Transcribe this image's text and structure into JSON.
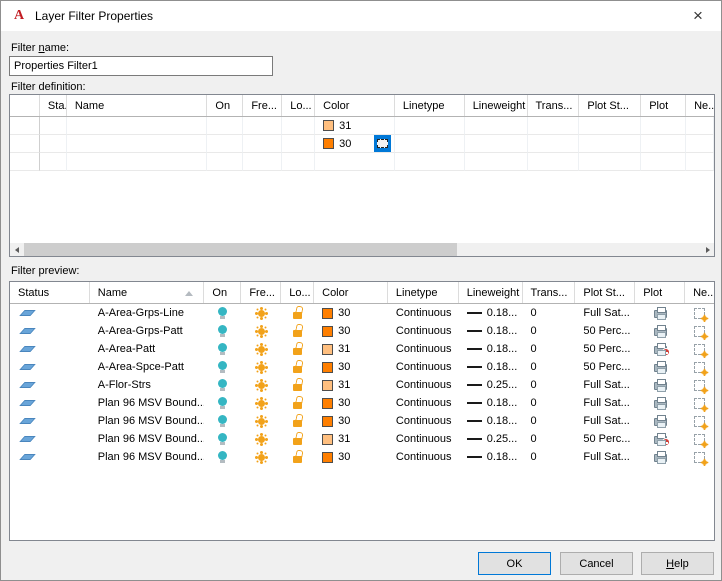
{
  "window": {
    "title": "Layer Filter Properties",
    "icon_letter": "A",
    "close_glyph": "×"
  },
  "filter_name": {
    "label_pre": "Filter ",
    "label_accel": "n",
    "label_post": "ame:",
    "value": "Properties Filter1"
  },
  "colors": {
    "accent": "#0078d7",
    "aci_30": "#FF7F00",
    "aci_31": "#FFBF7F",
    "titlebar": "#ffffff",
    "dialog_bg": "#f0f0f0"
  },
  "icons": {
    "app": "autocad-logo-icon",
    "close": "close-icon",
    "status": "layer-status-icon",
    "on": "lightbulb-on-icon",
    "freeze": "sun-thaw-icon",
    "lock": "unlock-icon",
    "plot": "printer-icon",
    "no_plot": "printer-no-plot-icon",
    "new_vp": "new-vp-freeze-icon",
    "sort": "sort-ascending-icon",
    "cell_select": "cell-select-icon"
  },
  "definition": {
    "label": "Filter definition:",
    "columns": [
      "",
      "Sta...",
      "Name",
      "On",
      "Fre...",
      "Lo...",
      "Color",
      "Linetype",
      "Lineweight",
      "Trans...",
      "Plot St...",
      "Plot",
      "Ne..."
    ],
    "rows": [
      {
        "color_value": "31",
        "color_key": "aci_31",
        "active_cell": false
      },
      {
        "color_value": "30",
        "color_key": "aci_30",
        "active_cell": true
      },
      {
        "color_value": "",
        "color_key": "",
        "active_cell": false
      }
    ]
  },
  "preview": {
    "label": "Filter preview:",
    "columns": [
      "Status",
      "Name",
      "On",
      "Fre...",
      "Lo...",
      "Color",
      "Linetype",
      "Lineweight",
      "Trans...",
      "Plot St...",
      "Plot",
      "Ne..."
    ],
    "sorted_column": "Name",
    "rows": [
      {
        "name": "A-Area-Grps-Line",
        "color_value": "30",
        "color_key": "aci_30",
        "linetype": "Continuous",
        "lineweight": "0.18...",
        "trans": "0",
        "plot_style": "Full Sat...",
        "plot": true
      },
      {
        "name": "A-Area-Grps-Patt",
        "color_value": "30",
        "color_key": "aci_30",
        "linetype": "Continuous",
        "lineweight": "0.18...",
        "trans": "0",
        "plot_style": "50 Perc...",
        "plot": true
      },
      {
        "name": "A-Area-Patt",
        "color_value": "31",
        "color_key": "aci_31",
        "linetype": "Continuous",
        "lineweight": "0.18...",
        "trans": "0",
        "plot_style": "50 Perc...",
        "plot": false
      },
      {
        "name": "A-Area-Spce-Patt",
        "color_value": "30",
        "color_key": "aci_30",
        "linetype": "Continuous",
        "lineweight": "0.18...",
        "trans": "0",
        "plot_style": "50 Perc...",
        "plot": true
      },
      {
        "name": "A-Flor-Strs",
        "color_value": "31",
        "color_key": "aci_31",
        "linetype": "Continuous",
        "lineweight": "0.25...",
        "trans": "0",
        "plot_style": "Full Sat...",
        "plot": true
      },
      {
        "name": "Plan 96 MSV Bound...",
        "color_value": "30",
        "color_key": "aci_30",
        "linetype": "Continuous",
        "lineweight": "0.18...",
        "trans": "0",
        "plot_style": "Full Sat...",
        "plot": true
      },
      {
        "name": "Plan 96 MSV Bound...",
        "color_value": "30",
        "color_key": "aci_30",
        "linetype": "Continuous",
        "lineweight": "0.18...",
        "trans": "0",
        "plot_style": "Full Sat...",
        "plot": true
      },
      {
        "name": "Plan 96 MSV Bound...",
        "color_value": "31",
        "color_key": "aci_31",
        "linetype": "Continuous",
        "lineweight": "0.25...",
        "trans": "0",
        "plot_style": "50 Perc...",
        "plot": false
      },
      {
        "name": "Plan 96 MSV Bound...",
        "color_value": "30",
        "color_key": "aci_30",
        "linetype": "Continuous",
        "lineweight": "0.18...",
        "trans": "0",
        "plot_style": "Full Sat...",
        "plot": true
      }
    ]
  },
  "buttons": {
    "ok": "OK",
    "cancel": "Cancel",
    "help_pre": "",
    "help_accel": "H",
    "help_post": "elp"
  }
}
